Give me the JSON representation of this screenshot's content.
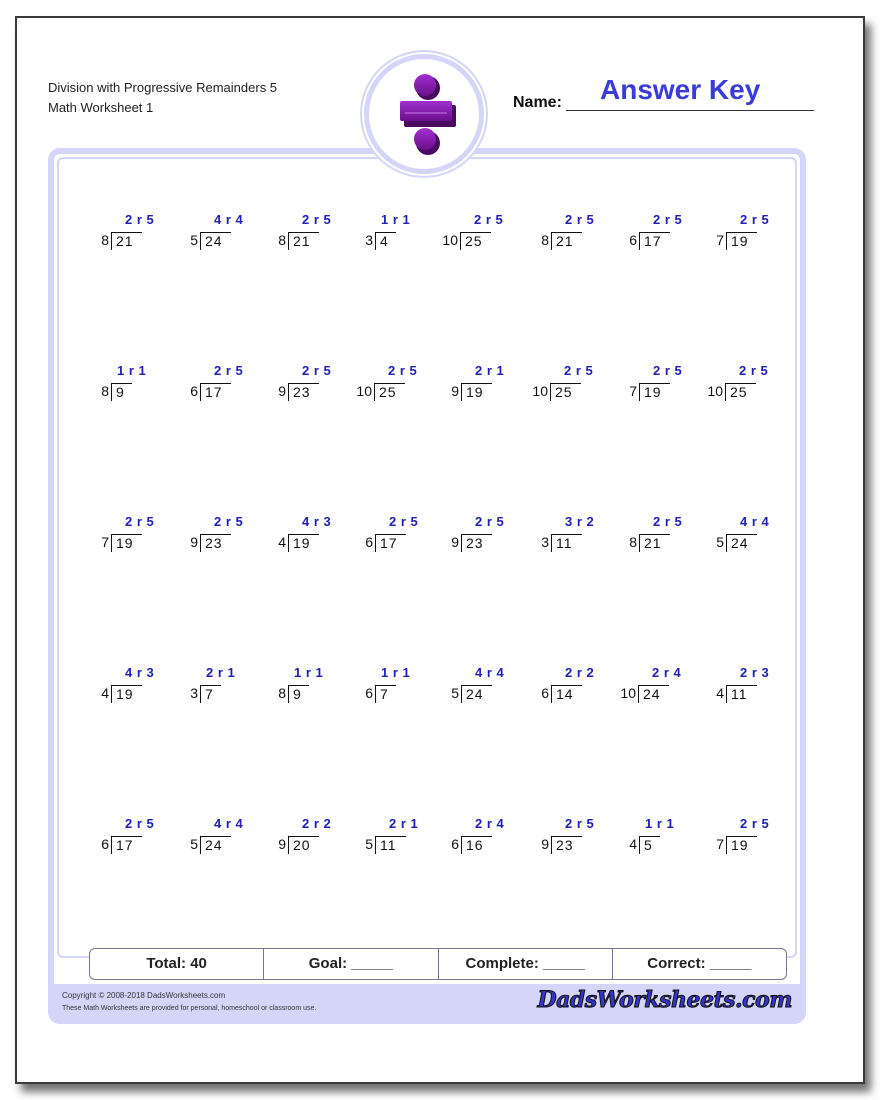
{
  "header": {
    "title_line1": "Division with Progressive Remainders 5",
    "title_line2": "Math Worksheet 1",
    "name_label": "Name:",
    "name_value": "Answer Key",
    "logo_icon": "division-sign-icon"
  },
  "colors": {
    "accent_blue": "#3b3bd9",
    "answer_blue": "#2020b8",
    "frame_lavender": "#d5d5fa",
    "logo_purple": "#8a1fb0"
  },
  "problems": [
    [
      {
        "divisor": "8",
        "dividend": "21",
        "answer": "2 r 5"
      },
      {
        "divisor": "5",
        "dividend": "24",
        "answer": "4 r 4"
      },
      {
        "divisor": "8",
        "dividend": "21",
        "answer": "2 r 5"
      },
      {
        "divisor": "3",
        "dividend": "4",
        "answer": "1 r 1"
      },
      {
        "divisor": "10",
        "dividend": "25",
        "answer": "2 r 5"
      },
      {
        "divisor": "8",
        "dividend": "21",
        "answer": "2 r 5"
      },
      {
        "divisor": "6",
        "dividend": "17",
        "answer": "2 r 5"
      },
      {
        "divisor": "7",
        "dividend": "19",
        "answer": "2 r 5"
      }
    ],
    [
      {
        "divisor": "8",
        "dividend": "9",
        "answer": "1 r 1"
      },
      {
        "divisor": "6",
        "dividend": "17",
        "answer": "2 r 5"
      },
      {
        "divisor": "9",
        "dividend": "23",
        "answer": "2 r 5"
      },
      {
        "divisor": "10",
        "dividend": "25",
        "answer": "2 r 5"
      },
      {
        "divisor": "9",
        "dividend": "19",
        "answer": "2 r 1"
      },
      {
        "divisor": "10",
        "dividend": "25",
        "answer": "2 r 5"
      },
      {
        "divisor": "7",
        "dividend": "19",
        "answer": "2 r 5"
      },
      {
        "divisor": "10",
        "dividend": "25",
        "answer": "2 r 5"
      }
    ],
    [
      {
        "divisor": "7",
        "dividend": "19",
        "answer": "2 r 5"
      },
      {
        "divisor": "9",
        "dividend": "23",
        "answer": "2 r 5"
      },
      {
        "divisor": "4",
        "dividend": "19",
        "answer": "4 r 3"
      },
      {
        "divisor": "6",
        "dividend": "17",
        "answer": "2 r 5"
      },
      {
        "divisor": "9",
        "dividend": "23",
        "answer": "2 r 5"
      },
      {
        "divisor": "3",
        "dividend": "11",
        "answer": "3 r 2"
      },
      {
        "divisor": "8",
        "dividend": "21",
        "answer": "2 r 5"
      },
      {
        "divisor": "5",
        "dividend": "24",
        "answer": "4 r 4"
      }
    ],
    [
      {
        "divisor": "4",
        "dividend": "19",
        "answer": "4 r 3"
      },
      {
        "divisor": "3",
        "dividend": "7",
        "answer": "2 r 1"
      },
      {
        "divisor": "8",
        "dividend": "9",
        "answer": "1 r 1"
      },
      {
        "divisor": "6",
        "dividend": "7",
        "answer": "1 r 1"
      },
      {
        "divisor": "5",
        "dividend": "24",
        "answer": "4 r 4"
      },
      {
        "divisor": "6",
        "dividend": "14",
        "answer": "2 r 2"
      },
      {
        "divisor": "10",
        "dividend": "24",
        "answer": "2 r 4"
      },
      {
        "divisor": "4",
        "dividend": "11",
        "answer": "2 r 3"
      }
    ],
    [
      {
        "divisor": "6",
        "dividend": "17",
        "answer": "2 r 5"
      },
      {
        "divisor": "5",
        "dividend": "24",
        "answer": "4 r 4"
      },
      {
        "divisor": "9",
        "dividend": "20",
        "answer": "2 r 2"
      },
      {
        "divisor": "5",
        "dividend": "11",
        "answer": "2 r 1"
      },
      {
        "divisor": "6",
        "dividend": "16",
        "answer": "2 r 4"
      },
      {
        "divisor": "9",
        "dividend": "23",
        "answer": "2 r 5"
      },
      {
        "divisor": "4",
        "dividend": "5",
        "answer": "1 r 1"
      },
      {
        "divisor": "7",
        "dividend": "19",
        "answer": "2 r 5"
      }
    ]
  ],
  "score": {
    "total": "Total: 40",
    "goal": "Goal: _____",
    "complete": "Complete: _____",
    "correct": "Correct: _____"
  },
  "footer": {
    "copyright": "Copyright © 2008-2018 DadsWorksheets.com",
    "usage": "These Math Worksheets are provided for personal, homeschool or classroom use.",
    "brand": "DadsWorksheets.com"
  }
}
